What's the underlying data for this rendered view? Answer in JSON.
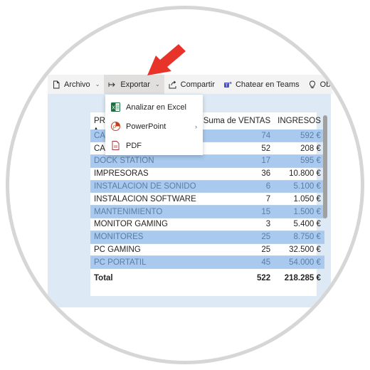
{
  "toolbar": {
    "archivo": "Archivo",
    "exportar": "Exportar",
    "compartir": "Compartir",
    "chatear": "Chatear en Teams",
    "obtener": "Obt"
  },
  "dropdown": {
    "items": [
      {
        "label": "Analizar en Excel",
        "icon": "excel-icon"
      },
      {
        "label": "PowerPoint",
        "icon": "powerpoint-icon"
      },
      {
        "label": "PDF",
        "icon": "pdf-icon"
      }
    ]
  },
  "table": {
    "headers": [
      "PR",
      "Suma de VENTAS",
      "INGRESOS"
    ],
    "rows": [
      {
        "name": "CA",
        "ventas": "74",
        "ingresos": "592 €"
      },
      {
        "name": "CA",
        "ventas": "52",
        "ingresos": "208 €"
      },
      {
        "name": "DOCK STATION",
        "ventas": "17",
        "ingresos": "595 €"
      },
      {
        "name": "IMPRESORAS",
        "ventas": "36",
        "ingresos": "10.800 €"
      },
      {
        "name": "INSTALACION DE SONIDO",
        "ventas": "6",
        "ingresos": "5.100 €"
      },
      {
        "name": "INSTALACION SOFTWARE",
        "ventas": "7",
        "ingresos": "1.050 €"
      },
      {
        "name": "MANTENIMIENTO",
        "ventas": "15",
        "ingresos": "1.500 €"
      },
      {
        "name": "MONITOR GAMING",
        "ventas": "3",
        "ingresos": "5.400 €"
      },
      {
        "name": "MONITORES",
        "ventas": "25",
        "ingresos": "8.750 €"
      },
      {
        "name": "PC GAMING",
        "ventas": "25",
        "ingresos": "32.500 €"
      },
      {
        "name": "PC PORTATIL",
        "ventas": "45",
        "ingresos": "54.000 €"
      }
    ],
    "total": {
      "label": "Total",
      "ventas": "522",
      "ingresos": "218.285 €"
    }
  },
  "colors": {
    "band": "#a9caee",
    "canvas": "#ddeaf6",
    "arrow": "#e8332a"
  }
}
